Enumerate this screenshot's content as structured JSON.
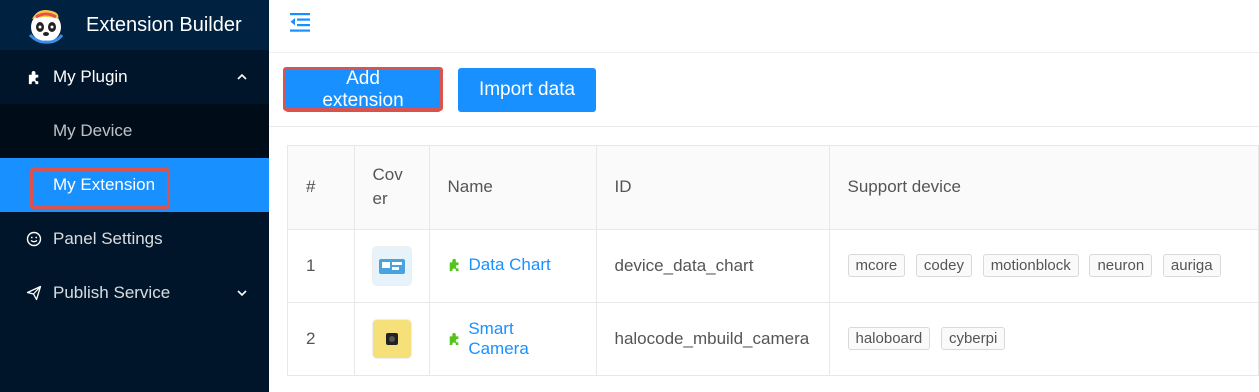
{
  "app": {
    "title": "Extension Builder"
  },
  "sidebar": {
    "items": [
      {
        "label": "My Plugin"
      },
      {
        "label": "My Device"
      },
      {
        "label": "My Extension"
      },
      {
        "label": "Panel Settings"
      },
      {
        "label": "Publish Service"
      }
    ]
  },
  "toolbar": {
    "add_label": "Add extension",
    "import_label": "Import data"
  },
  "table": {
    "headers": [
      "#",
      "Cov",
      "er",
      "Name",
      "ID",
      "Support device"
    ],
    "rows": [
      {
        "num": "1",
        "name": "Data Chart",
        "id": "device_data_chart",
        "devices": [
          "mcore",
          "codey",
          "motionblock",
          "neuron",
          "auriga"
        ]
      },
      {
        "num": "2",
        "name": "Smart Camera",
        "id": "halocode_mbuild_camera",
        "devices": [
          "haloboard",
          "cyberpi"
        ]
      }
    ]
  },
  "colors": {
    "primary": "#1890ff",
    "sidebar": "#001529",
    "highlight": "#d9534f",
    "plugin_icon": "#52c41a"
  }
}
